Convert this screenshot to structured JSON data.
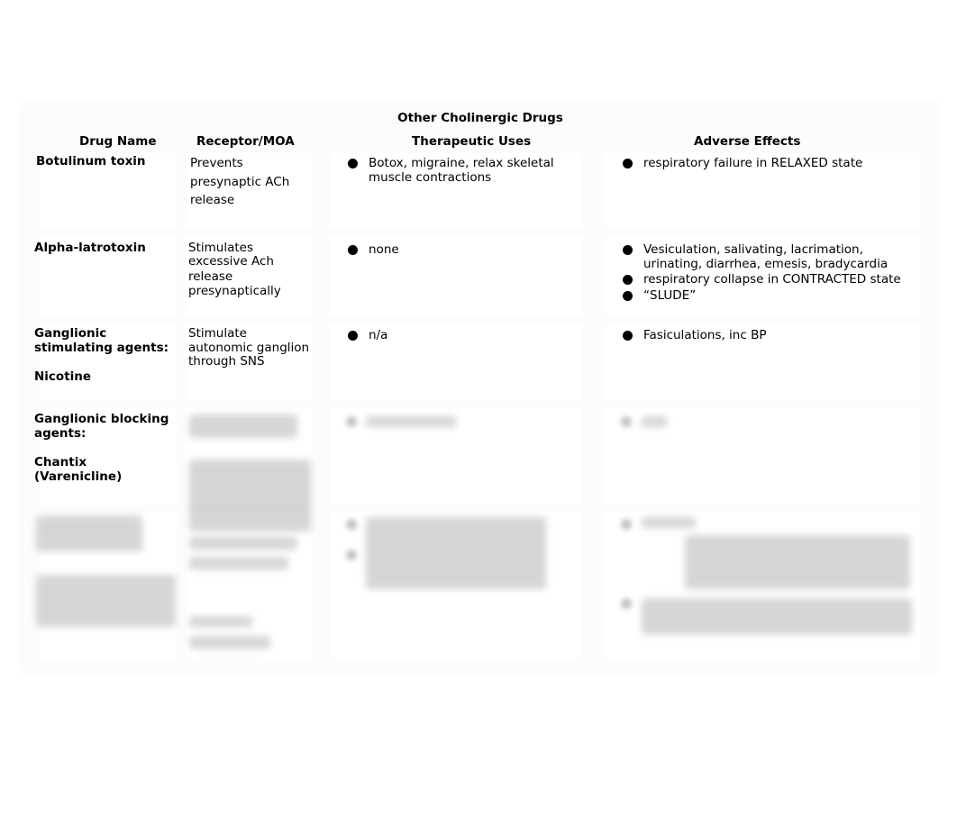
{
  "document": {
    "title": "Other Cholinergic Drugs",
    "columns": [
      "Drug Name",
      "Receptor/MOA",
      "Therapeutic Uses",
      "Adverse Effects"
    ],
    "rows": [
      {
        "drug_name": [
          "Botulinum toxin"
        ],
        "moa": [
          "Prevents",
          "presynaptic ACh",
          "release"
        ],
        "uses": [
          [
            "Botox, migraine, relax skeletal",
            "muscle contractions"
          ]
        ],
        "adverse": [
          [
            "respiratory failure in RELAXED state"
          ]
        ]
      },
      {
        "drug_name": [
          "Alpha-latrotoxin"
        ],
        "moa": [
          "Stimulates",
          "excessive Ach",
          "release",
          "presynaptically"
        ],
        "uses": [
          [
            "none"
          ]
        ],
        "adverse": [
          [
            "Vesiculation, salivating, lacrimation,",
            "urinating, diarrhea, emesis, bradycardia"
          ],
          [
            " respiratory collapse in CONTRACTED state"
          ],
          [
            "“SLUDE”"
          ]
        ]
      },
      {
        "drug_name": [
          "Ganglionic",
          "stimulating agents:",
          "",
          "Nicotine"
        ],
        "moa": [
          "Stimulate",
          "autonomic ganglion",
          "through SNS"
        ],
        "uses": [
          [
            "n/a"
          ]
        ],
        "adverse": [
          [
            "Fasiculations, inc BP"
          ]
        ]
      },
      {
        "drug_name": [
          "Ganglionic blocking",
          "agents:",
          "",
          "Chantix",
          "(Varenicline)"
        ],
        "moa_blurred": true,
        "uses_blurred": true,
        "adverse_blurred": true
      },
      {
        "drug_name_blurred": true,
        "moa_blurred": true,
        "uses_blurred": true,
        "adverse_blurred": true
      }
    ]
  }
}
